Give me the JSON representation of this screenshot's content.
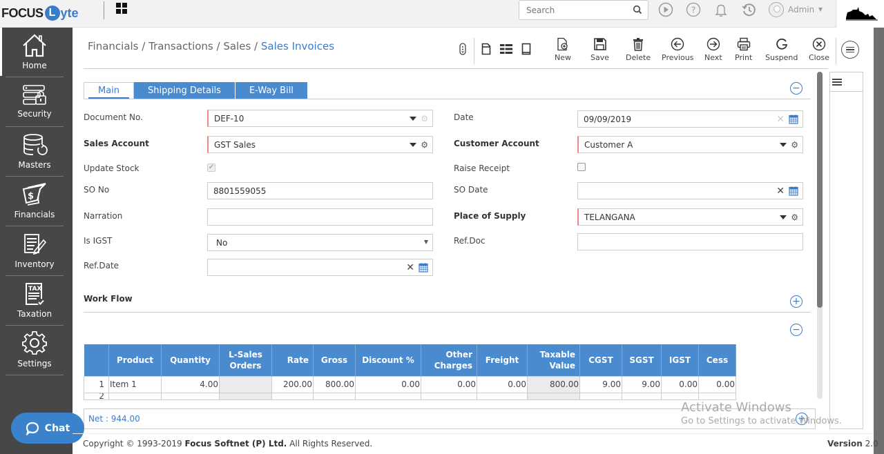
{
  "topbar": {
    "logo_prefix": "FOCUS",
    "logo_letter": "L",
    "logo_suffix": "yte",
    "search_placeholder": "Search",
    "user_name": "Admin",
    "icons": [
      "apps-grid-icon",
      "play-icon",
      "help-icon",
      "bell-icon",
      "history-icon",
      "user-avatar-icon",
      "company-logo-icon"
    ]
  },
  "sidebar": {
    "items": [
      {
        "label": "Home",
        "icon": "home-icon"
      },
      {
        "label": "Security",
        "icon": "security-icon"
      },
      {
        "label": "Masters",
        "icon": "masters-icon"
      },
      {
        "label": "Financials",
        "icon": "financials-icon"
      },
      {
        "label": "Inventory",
        "icon": "inventory-icon"
      },
      {
        "label": "Taxation",
        "icon": "taxation-icon"
      },
      {
        "label": "Settings",
        "icon": "settings-icon"
      }
    ]
  },
  "breadcrumb": {
    "items": [
      "Financials /",
      "Transactions /",
      "Sales /"
    ],
    "current": "Sales Invoices"
  },
  "toolbar": {
    "buttons": [
      {
        "label": "New",
        "icon": "new-document-icon"
      },
      {
        "label": "Save",
        "icon": "save-icon"
      },
      {
        "label": "Delete",
        "icon": "trash-icon"
      },
      {
        "label": "Previous",
        "icon": "arrow-left-circle-icon"
      },
      {
        "label": "Next",
        "icon": "arrow-right-circle-icon"
      },
      {
        "label": "Print",
        "icon": "printer-icon"
      },
      {
        "label": "Suspend",
        "icon": "suspend-icon"
      },
      {
        "label": "Close",
        "icon": "close-circle-icon"
      }
    ]
  },
  "tabs": [
    {
      "label": "Main",
      "active": true
    },
    {
      "label": "Shipping Details",
      "active": false
    },
    {
      "label": "E-Way Bill",
      "active": false
    }
  ],
  "form": {
    "document_no": {
      "label": "Document No.",
      "value": "DEF-10"
    },
    "sales_account": {
      "label": "Sales Account",
      "value": "GST Sales"
    },
    "update_stock": {
      "label": "Update Stock",
      "checked": true
    },
    "so_no": {
      "label": "SO No",
      "value": "8801559055"
    },
    "narration": {
      "label": "Narration",
      "value": ""
    },
    "is_igst": {
      "label": "Is IGST",
      "value": "No"
    },
    "ref_date": {
      "label": "Ref.Date",
      "value": ""
    },
    "date": {
      "label": "Date",
      "value": "09/09/2019"
    },
    "customer_account": {
      "label": "Customer Account",
      "value": "Customer A"
    },
    "raise_receipt": {
      "label": "Raise Receipt",
      "checked": false
    },
    "so_date": {
      "label": "SO Date",
      "value": ""
    },
    "place_of_supply": {
      "label": "Place of Supply",
      "value": "TELANGANA"
    },
    "ref_doc": {
      "label": "Ref.Doc",
      "value": ""
    }
  },
  "workflow": {
    "label": "Work Flow"
  },
  "grid": {
    "columns": [
      "",
      "Product",
      "Quantity",
      "L-Sales Orders",
      "Rate",
      "Gross",
      "Discount %",
      "Other Charges",
      "Freight",
      "Taxable Value",
      "CGST",
      "SGST",
      "IGST",
      "Cess"
    ],
    "rows": [
      [
        "1",
        "Item 1",
        "4.00",
        "",
        "200.00",
        "800.00",
        "0.00",
        "0.00",
        "0.00",
        "800.00",
        "9.00",
        "9.00",
        "0.00",
        "0.00"
      ],
      [
        "2",
        "",
        "",
        "",
        "",
        "",
        "",
        "",
        "",
        "",
        "",
        "",
        "",
        ""
      ]
    ]
  },
  "net": {
    "label": "Net :",
    "value": "944.00"
  },
  "chat": {
    "label": "Chat"
  },
  "footer": {
    "copyright_prefix": "Copyright © 1993-2019",
    "company": "Focus Softnet (P) Ltd.",
    "rights": "All Rights Reserved.",
    "version_label": "Version",
    "version_number": "2.0"
  },
  "watermark": {
    "line1": "Activate Windows",
    "line2": "Go to Settings to activate Windows."
  }
}
